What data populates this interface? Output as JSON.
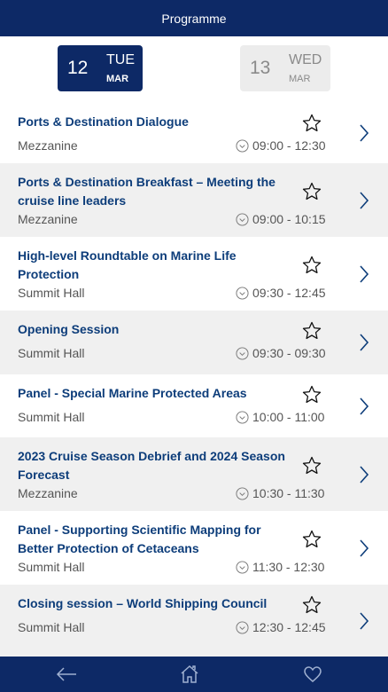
{
  "header": {
    "title": "Programme"
  },
  "dates": [
    {
      "day": "12",
      "weekday": "TUE",
      "month": "MAR",
      "active": true
    },
    {
      "day": "13",
      "weekday": "WED",
      "month": "MAR",
      "active": false
    }
  ],
  "sessions": [
    {
      "title": "Ports & Destination Dialogue",
      "location": "Mezzanine",
      "time": "09:00 - 12:30"
    },
    {
      "title": "Ports & Destination Breakfast – Meeting the cruise line leaders",
      "location": "Mezzanine",
      "time": "09:00 - 10:15"
    },
    {
      "title": "High-level Roundtable on Marine Life Protection",
      "location": "Summit Hall",
      "time": "09:30 - 12:45"
    },
    {
      "title": "Opening Session",
      "location": "Summit Hall",
      "time": "09:30 - 09:30"
    },
    {
      "title": "Panel - Special Marine Protected Areas",
      "location": "Summit Hall",
      "time": "10:00 - 11:00"
    },
    {
      "title": "2023 Cruise Season Debrief and 2024 Season Forecast",
      "location": "Mezzanine",
      "time": "10:30 - 11:30"
    },
    {
      "title": "Panel - Supporting Scientific Mapping for Better Protection of Cetaceans",
      "location": "Summit Hall",
      "time": "11:30 - 12:30"
    },
    {
      "title": "Closing session – World Shipping Council",
      "location": "Summit Hall",
      "time": "12:30 - 12:45"
    }
  ],
  "footer": {
    "icons": [
      "back-arrow-icon",
      "home-icon",
      "heart-icon"
    ]
  },
  "colors": {
    "brand": "#0d2966",
    "title_text": "#0d3d7a",
    "row_alt": "#f0f0f0"
  }
}
